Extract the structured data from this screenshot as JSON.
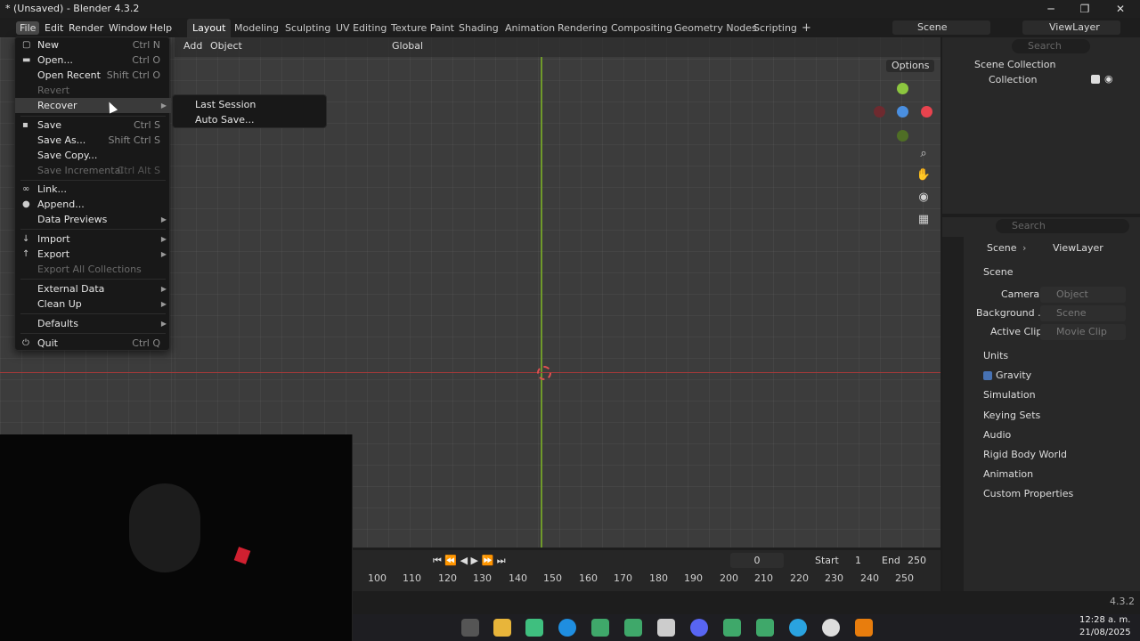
{
  "window": {
    "title": "* (Unsaved) - Blender 4.3.2",
    "minimize": "─",
    "maximize": "❐",
    "close": "✕"
  },
  "menubar": {
    "items": [
      "File",
      "Edit",
      "Render",
      "Window",
      "Help"
    ]
  },
  "workspaces": [
    "Layout",
    "Modeling",
    "Sculpting",
    "UV Editing",
    "Texture Paint",
    "Shading",
    "Animation",
    "Rendering",
    "Compositing",
    "Geometry Nodes",
    "Scripting"
  ],
  "add_workspace": "+",
  "scene_selector": {
    "label": "Scene"
  },
  "viewlayer_selector": {
    "label": "ViewLayer"
  },
  "viewport_header": {
    "add": "Add",
    "object": "Object",
    "orientation": "Global",
    "options": "Options"
  },
  "file_menu": {
    "items": [
      {
        "label": "New",
        "shortcut": "Ctrl N",
        "icon": "▢"
      },
      {
        "label": "Open...",
        "shortcut": "Ctrl O",
        "icon": "▬"
      },
      {
        "label": "Open Recent",
        "shortcut": "Shift Ctrl O"
      },
      {
        "label": "Revert",
        "shortcut": ""
      },
      {
        "label": "Recover",
        "shortcut": ""
      },
      {
        "label": "Save",
        "shortcut": "Ctrl S",
        "icon": "▪"
      },
      {
        "label": "Save As...",
        "shortcut": "Shift Ctrl S"
      },
      {
        "label": "Save Copy...",
        "shortcut": ""
      },
      {
        "label": "Save Incremental",
        "shortcut": "Ctrl Alt S"
      },
      {
        "label": "Link...",
        "shortcut": "",
        "icon": "∞"
      },
      {
        "label": "Append...",
        "shortcut": "",
        "icon": "●"
      },
      {
        "label": "Data Previews",
        "shortcut": ""
      },
      {
        "label": "Import",
        "shortcut": "",
        "icon": "↓"
      },
      {
        "label": "Export",
        "shortcut": "",
        "icon": "↑"
      },
      {
        "label": "Export All Collections",
        "shortcut": ""
      },
      {
        "label": "External Data",
        "shortcut": ""
      },
      {
        "label": "Clean Up",
        "shortcut": ""
      },
      {
        "label": "Defaults",
        "shortcut": ""
      },
      {
        "label": "Quit",
        "shortcut": "Ctrl Q",
        "icon": "⏻"
      }
    ]
  },
  "recover_submenu": {
    "items": [
      "Last Session",
      "Auto Save..."
    ]
  },
  "outliner": {
    "search_placeholder": "Search",
    "scene_collection": "Scene Collection",
    "collection": "Collection"
  },
  "properties": {
    "search_placeholder": "Search",
    "breadcrumb": [
      "Scene",
      "ViewLayer"
    ],
    "scene_panel": "Scene",
    "camera_label": "Camera",
    "camera_placeholder": "Object",
    "background_label": "Background ...",
    "background_placeholder": "Scene",
    "active_clip_label": "Active Clip",
    "active_clip_placeholder": "Movie Clip",
    "panels": [
      "Units",
      "Gravity",
      "Simulation",
      "Keying Sets",
      "Audio",
      "Rigid Body World",
      "Animation",
      "Custom Properties"
    ]
  },
  "timeline": {
    "current_frame": "0",
    "start_label": "Start",
    "start": "1",
    "end_label": "End",
    "end": "250",
    "ruler": [
      "100",
      "110",
      "120",
      "130",
      "140",
      "150",
      "160",
      "170",
      "180",
      "190",
      "200",
      "210",
      "220",
      "230",
      "240",
      "250"
    ]
  },
  "statusbar": {
    "version": "4.3.2"
  },
  "taskbar": {
    "time": "12:28 a. m.",
    "date": "21/08/2025"
  },
  "colors": {
    "accent": "#4772b3",
    "x_axis": "#a33a3a",
    "y_axis": "#6f9a2a",
    "gizmo_x": "#e8434e",
    "gizmo_y": "#8cc63f",
    "gizmo_z": "#4a8fe0"
  }
}
